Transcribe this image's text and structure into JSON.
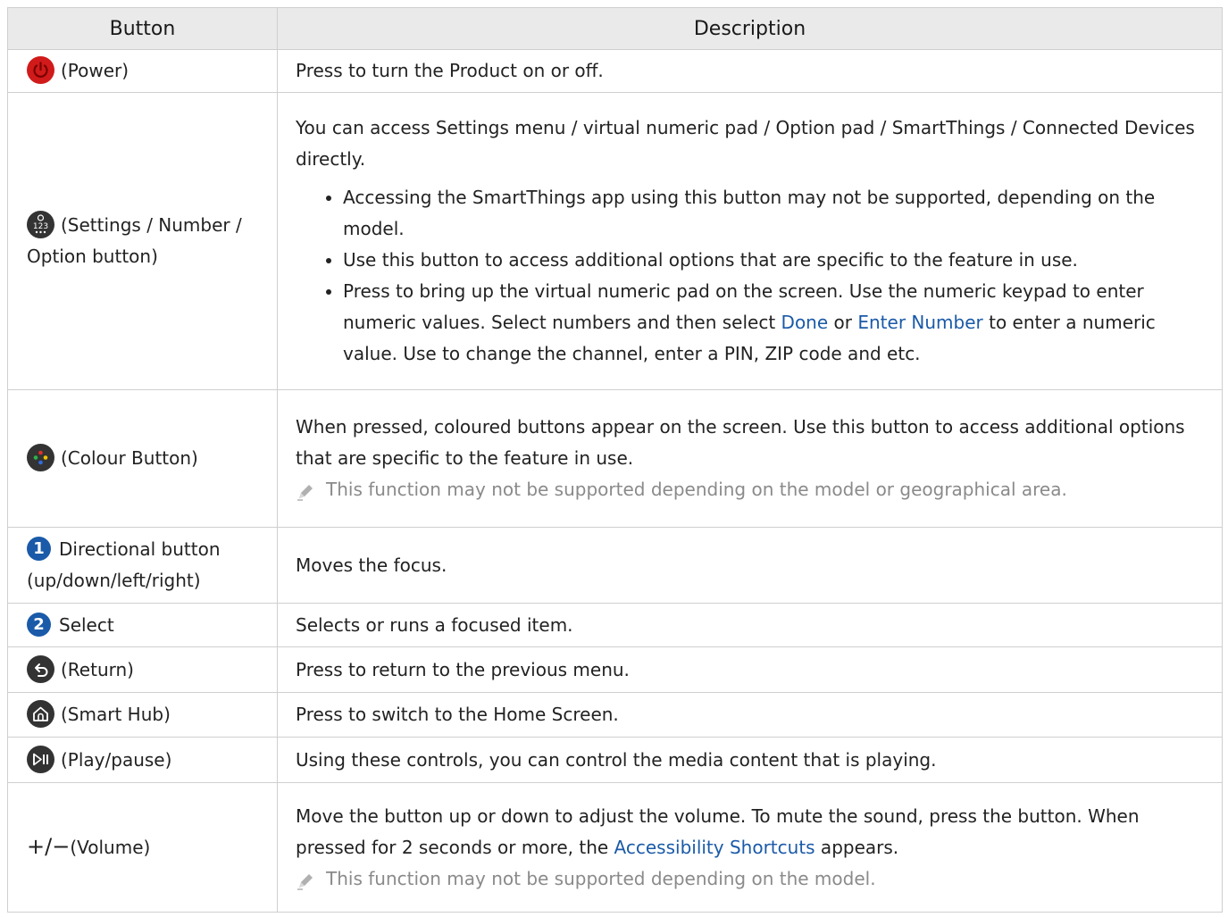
{
  "table": {
    "headers": [
      "Button",
      "Description"
    ],
    "rows": [
      {
        "icon": "power-icon",
        "label": "(Power)",
        "text": "Press to turn the Product on or off."
      },
      {
        "icon": "settings-number-option-icon",
        "label": "(Settings / Number / Option button)",
        "intro": "You can access Settings menu / virtual numeric pad / Option pad / SmartThings / Connected Devices directly.",
        "bullets": [
          "Accessing the SmartThings app using this button may not be supported, depending on the model.",
          "Use this button to access additional options that are specific to the feature in use."
        ],
        "bullet3": {
          "a": "Press to bring up the virtual numeric pad on the screen. Use the numeric keypad to enter numeric values. Select numbers and then select ",
          "link1": "Done",
          "b": " or ",
          "link2": "Enter Number",
          "c": " to enter a numeric value. Use to change the channel, enter a PIN, ZIP code and etc."
        }
      },
      {
        "icon": "colour-button-icon",
        "label": "(Colour Button)",
        "text": "When pressed, coloured buttons appear on the screen. Use this button to access additional options that are specific to the feature in use.",
        "note": "This function may not be supported depending on the model or geographical area."
      },
      {
        "badge": "1",
        "label": "Directional button (up/down/left/right)",
        "text": "Moves the focus."
      },
      {
        "badge": "2",
        "label": "Select",
        "text": "Selects or runs a focused item."
      },
      {
        "icon": "return-icon",
        "label": "(Return)",
        "text": "Press to return to the previous menu."
      },
      {
        "icon": "smart-hub-home-icon",
        "label": "(Smart Hub)",
        "text": "Press to switch to the Home Screen."
      },
      {
        "icon": "play-pause-icon",
        "label": "(Play/pause)",
        "text": "Using these controls, you can control the media content that is playing."
      },
      {
        "symbol": "+/−",
        "label": "(Volume)",
        "text_a": "Move the button up or down to adjust the volume. To mute the sound, press the button. When pressed for 2 seconds or more, the ",
        "link": "Accessibility Shortcuts",
        "text_b": " appears.",
        "note": "This function may not be supported depending on the model."
      }
    ]
  },
  "colors": {
    "link": "#1a5aa8",
    "header_bg": "#eaeaea",
    "icon_dark": "#333333",
    "power_red": "#d11a1a",
    "note_grey": "#8a8a8a"
  }
}
